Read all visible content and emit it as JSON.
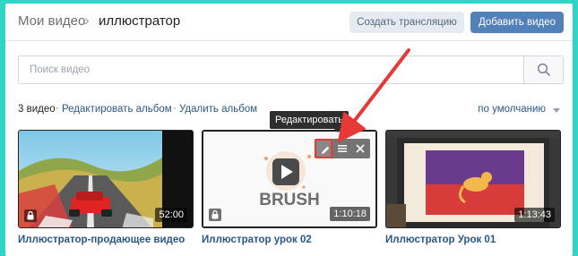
{
  "header": {
    "breadcrumb_root": "Мои видео",
    "breadcrumb_sep": "›",
    "breadcrumb_current": "иллюстратор",
    "create_stream_label": "Создать трансляцию",
    "add_video_label": "Добавить видео"
  },
  "search": {
    "placeholder": "Поиск видео",
    "value": "",
    "icon": "search-icon"
  },
  "toolbar": {
    "count": "3 видео",
    "edit_album": "Редактировать альбом",
    "delete_album": "Удалить альбом",
    "separator": "·",
    "sort": "по умолчанию"
  },
  "tooltip": "Редактировать",
  "videos": [
    {
      "title": "Иллюстратор-продающее видео",
      "duration": "52:00",
      "private": true
    },
    {
      "title": "Иллюстратор урок 02",
      "duration": "1:10:18",
      "private": true,
      "thumb_text": "BRUSH"
    },
    {
      "title": "Иллюстратор Урок 01",
      "duration": "1:13:43",
      "private": false
    }
  ],
  "colors": {
    "accent": "#5181b8",
    "link": "#2a5885",
    "annotation": "#e53935",
    "frame": "#2fd6c7"
  }
}
